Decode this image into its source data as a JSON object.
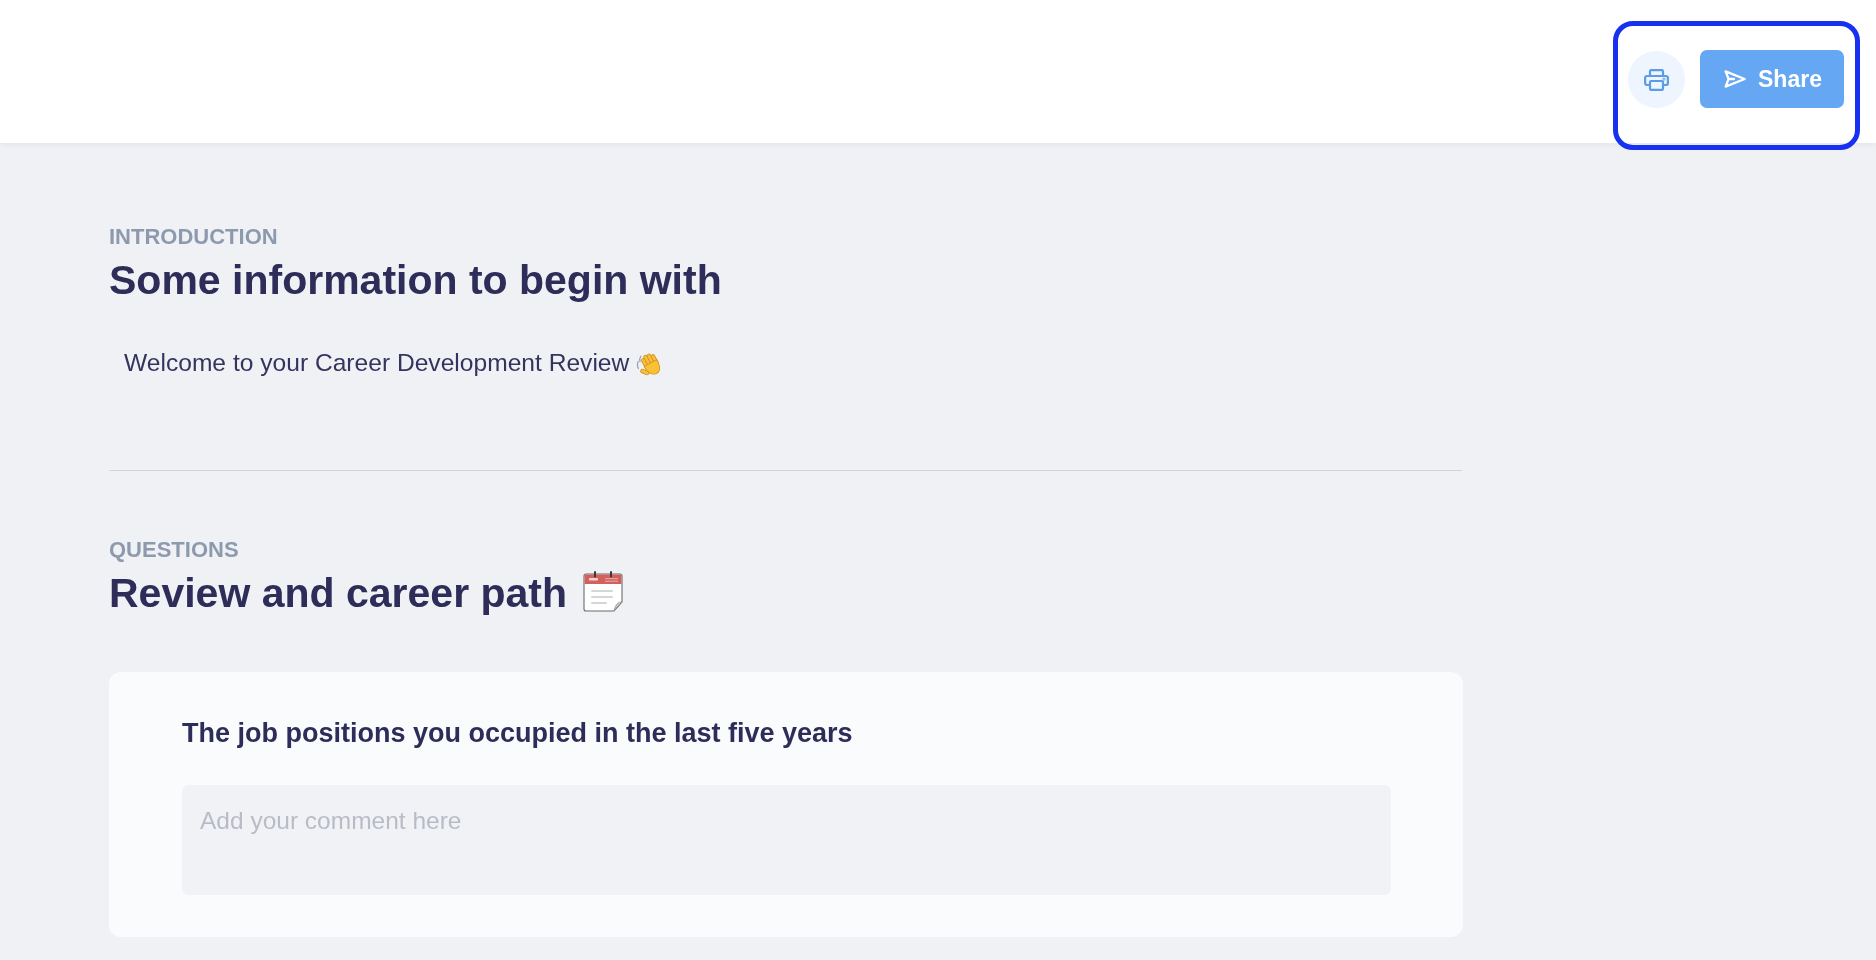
{
  "header": {
    "share_button": {
      "label": "Share"
    }
  },
  "introduction": {
    "label": "INTRODUCTION",
    "title": "Some information to begin with",
    "text": "Welcome to your Career Development Review"
  },
  "questions": {
    "label": "QUESTIONS",
    "title": "Review and career path",
    "items": [
      {
        "title": "The job positions you occupied in the last five years",
        "placeholder": "Add your comment here"
      }
    ]
  }
}
